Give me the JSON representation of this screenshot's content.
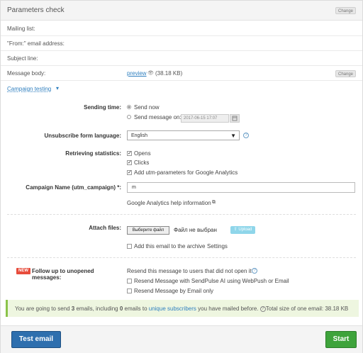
{
  "header": {
    "title": "Parameters check",
    "change_label": "Change"
  },
  "rows": {
    "mailing_list": "Mailing list:",
    "from_email": "\"From:\" email address:",
    "subject_line": "Subject line:",
    "message_body": "Message body:",
    "preview_link": "preview",
    "body_size": "(38.18 KB)",
    "change_label": "Change"
  },
  "campaign_testing": {
    "label": "Campaign testing",
    "arrow": "▾"
  },
  "sending_time": {
    "label": "Sending time:",
    "send_now": "Send now",
    "send_on": "Send message on:",
    "date_value": "2017-06-15 17:07",
    "selected": "send_now"
  },
  "unsubscribe": {
    "label": "Unsubscribe form language:",
    "value": "English"
  },
  "statistics": {
    "label": "Retrieving statistics:",
    "opens": "Opens",
    "clicks": "Clicks",
    "utm": "Add utm-parameters for Google Analytics",
    "checks": {
      "opens": true,
      "clicks": true,
      "utm": true
    }
  },
  "campaign_name": {
    "label": "Campaign Name (utm_campaign) *:",
    "value": "m",
    "help_link": "Google Analytics help information"
  },
  "attach": {
    "label": "Attach files:",
    "choose_btn": "Выберите файл",
    "no_file": "Файл не выбран",
    "upload_btn": "Upload",
    "archive": "Add this email to the archive",
    "settings_link": "Settings"
  },
  "follow_up": {
    "badge": "NEW",
    "label": "Follow up to unopened messages:",
    "resend_text": "Resend this message to users that did not open it",
    "option_webpush": "Resend Message with SendPulse AI using WebPush or Email",
    "option_email": "Resend Message by Email only"
  },
  "info": {
    "part1": "You are going to send ",
    "emails_count": "3",
    "part2": " emails, including ",
    "mailed_count": "0",
    "part3": " emails to ",
    "unique_link": "unique subscribers",
    "part4": " you have mailed before. ",
    "size_text": "Total size of one email: 38.18 KB"
  },
  "footer": {
    "test_btn": "Test email",
    "start_btn": "Start"
  },
  "colors": {
    "accent_blue": "#2e6fae",
    "start_green": "#3ea33b",
    "link": "#2f7fbf",
    "new_badge": "#e74c3c"
  }
}
